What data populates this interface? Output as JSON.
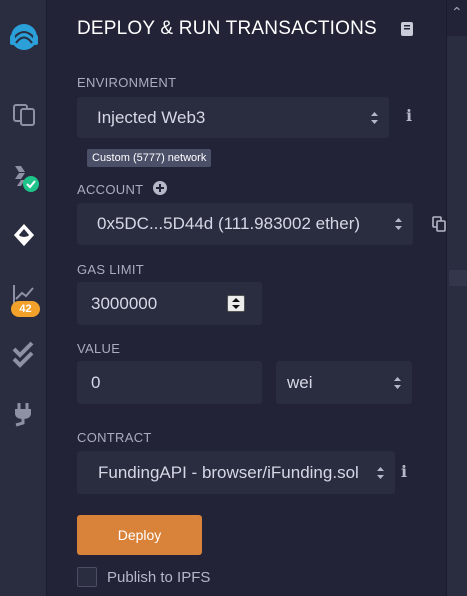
{
  "panel": {
    "title": "DEPLOY & RUN TRANSACTIONS"
  },
  "sidebar": {
    "badge_count": "42",
    "icons": [
      "remix-logo-icon",
      "file-explorer-icon",
      "solidity-compiler-icon",
      "deploy-run-icon",
      "analysis-icon",
      "testing-icon",
      "plugin-manager-icon"
    ]
  },
  "environment": {
    "label": "ENVIRONMENT",
    "value": "Injected Web3",
    "network_tooltip": "Custom (5777) network"
  },
  "account": {
    "label": "ACCOUNT",
    "value": "0x5DC...5D44d (111.983002 ether)"
  },
  "gas_limit": {
    "label": "GAS LIMIT",
    "value": "3000000"
  },
  "value": {
    "label": "VALUE",
    "amount": "0",
    "unit": "wei"
  },
  "contract": {
    "label": "CONTRACT",
    "value": "FundingAPI - browser/iFunding.sol"
  },
  "actions": {
    "deploy_label": "Deploy",
    "publish_ipfs_label": "Publish to IPFS"
  },
  "colors": {
    "background": "#222336",
    "field": "#2a2c3f",
    "deploy": "#d8823a",
    "badge": "#f2a22b",
    "success": "#1ec48a",
    "accent_blue": "#2ba0d9"
  }
}
